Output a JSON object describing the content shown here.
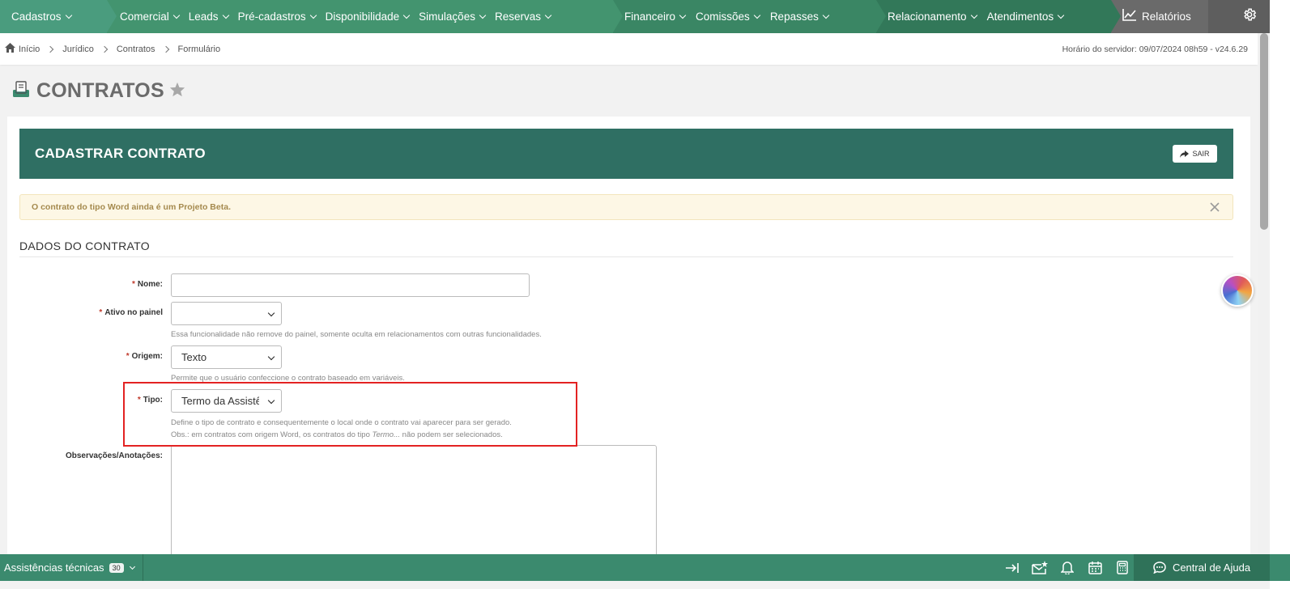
{
  "nav": {
    "groups": [
      [
        {
          "label": "Cadastros"
        }
      ],
      [
        {
          "label": "Comercial"
        },
        {
          "label": "Leads"
        },
        {
          "label": "Pré-cadastros"
        },
        {
          "label": "Disponibilidade"
        },
        {
          "label": "Simulações"
        },
        {
          "label": "Reservas"
        }
      ],
      [
        {
          "label": "Financeiro"
        },
        {
          "label": "Comissões"
        },
        {
          "label": "Repasses"
        }
      ],
      [
        {
          "label": "Relacionamento"
        },
        {
          "label": "Atendimentos"
        }
      ]
    ],
    "reports_label": "Relatórios"
  },
  "breadcrumb": {
    "items": [
      "Início",
      "Jurídico",
      "Contratos",
      "Formulário"
    ],
    "server_time": "Horário do servidor: 09/07/2024 08h59 - v24.6.29"
  },
  "page": {
    "title": "CONTRATOS"
  },
  "card": {
    "title": "CADASTRAR CONTRATO",
    "exit_label": "SAIR",
    "alert": "O contrato do tipo Word ainda é um Projeto Beta.",
    "section": "DADOS DO CONTRATO"
  },
  "form": {
    "required_mark": "*",
    "nome": {
      "label": "Nome:",
      "value": ""
    },
    "ativo": {
      "label": "Ativo no painel",
      "value": "",
      "help": "Essa funcionalidade não remove do painel, somente oculta em relacionamentos com outras funcionalidades."
    },
    "origem": {
      "label": "Origem:",
      "value": "Texto",
      "help": "Permite que o usuário confeccione o contrato baseado em variáveis."
    },
    "tipo": {
      "label": "Tipo:",
      "value": "Termo da Assistência",
      "help_1": "Define o tipo de contrato e consequentemente o local onde o contrato vai aparecer para ser gerado.",
      "help_2_prefix": "Obs.: em contratos com origem Word, os contratos do tipo ",
      "help_2_em": "Termo...",
      "help_2_suffix": " não podem ser selecionados."
    },
    "obs": {
      "label": "Observações/Anotações:",
      "value": ""
    }
  },
  "bottombar": {
    "label": "Assistências técnicas",
    "badge": "30",
    "help_label": "Central de Ajuda"
  },
  "colors": {
    "brand_green": "#3b8a6e",
    "header_teal": "#2f6f63",
    "highlight": "#e32222"
  }
}
